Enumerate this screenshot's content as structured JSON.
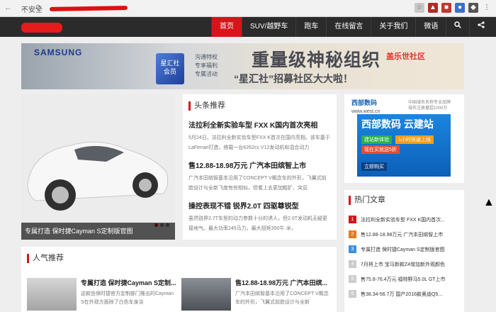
{
  "browser": {
    "security_label": "不安全",
    "nav_glyphs": "← → ⟳"
  },
  "nav": {
    "items": [
      {
        "label": "首页",
        "active": true
      },
      {
        "label": "SUV/越野车"
      },
      {
        "label": "跑车"
      },
      {
        "label": "在线留言"
      },
      {
        "label": "关于我们"
      },
      {
        "label": "微语"
      }
    ]
  },
  "banner": {
    "brand": "SAMSUNG",
    "card_text": "星汇社\n会员",
    "perks": [
      "沟通特权",
      "专享福利",
      "专属活动"
    ],
    "headline": "重量级神秘组织",
    "subheadline": "“星汇社”招募社区大大啦！",
    "community": "盖乐世社区"
  },
  "slider": {
    "caption": "专属打造 保时捷Cayman S定制版官图"
  },
  "headlines": {
    "title": "头条推荐",
    "items": [
      {
        "title": "法拉利全新实验车型 FXX K国内首次亮相",
        "desc": "5月24日，法拉利全新实验车型FXX K首次在国内亮相。该车基于LaFerrari打造，搭载一台6262cc V12发动机和混合动力"
      },
      {
        "title": "售12.88-18.98万元 广汽本田缤智上市",
        "desc": "广汽本田缤智基本沿用了CONCEPT V概念车的外形，飞翼式前脸设计与全新飞度有些相似，但看上去更加粗犷、突显"
      },
      {
        "title": "操控表现不错 锐界2.0T 四驱尊锐型",
        "desc": "虽然锐界2.7T车型的动力参数十分的诱人，但2.0T发动机无疑更接地气。最大功率245马力，最大扭矩350牛·米，"
      }
    ]
  },
  "ad": {
    "brand": "西部数码",
    "brand_url": "www.west.cn",
    "brand_sub": "中国域名名称专业品牌\n域名注册量超1000万",
    "product": "西部数码 云建站",
    "btn1": "建站新体验",
    "btn2": "1小时快速上线",
    "btn3": "现在买就送5折",
    "btn4": "立即购买"
  },
  "hot": {
    "title": "热门文章",
    "items": [
      {
        "num": "1",
        "text": "法拉利全新实验车型 FXX K国内首次..."
      },
      {
        "num": "2",
        "text": "售12.88-18.98万元 广汽本田缤智上市"
      },
      {
        "num": "3",
        "text": "专属打造 保时捷Cayman S定制版官图"
      },
      {
        "num": "4",
        "text": "7月将上市 宝马新款Z4增加新外观颜色"
      },
      {
        "num": "5",
        "text": "售75.8-76.4万元 福特野马5.0L GT上市"
      },
      {
        "num": "6",
        "text": "售38.34-56.7万 国产2016款奥迪Q5..."
      }
    ],
    "colors": {
      "1": "#d9131b",
      "2": "#e8791d",
      "3": "#3a91e0",
      "default": "#cccccc"
    }
  },
  "popular": {
    "title": "人气推荐",
    "items": [
      {
        "title": "专属打造 保时捷Cayman S定制...",
        "desc": "这款由保时捷官方定制部门推出的Cayman S在外观方面除了白色车身涂"
      },
      {
        "title": "售12.88-18.98万元 广汽本田缤...",
        "desc": "广汽本田缤智基本沿用了CONCEPT V概念车的外形，飞翼式前脸设计与全新"
      }
    ]
  },
  "colors": {
    "accent": "#d9131b",
    "nav_bg": "#2b2b2b"
  }
}
